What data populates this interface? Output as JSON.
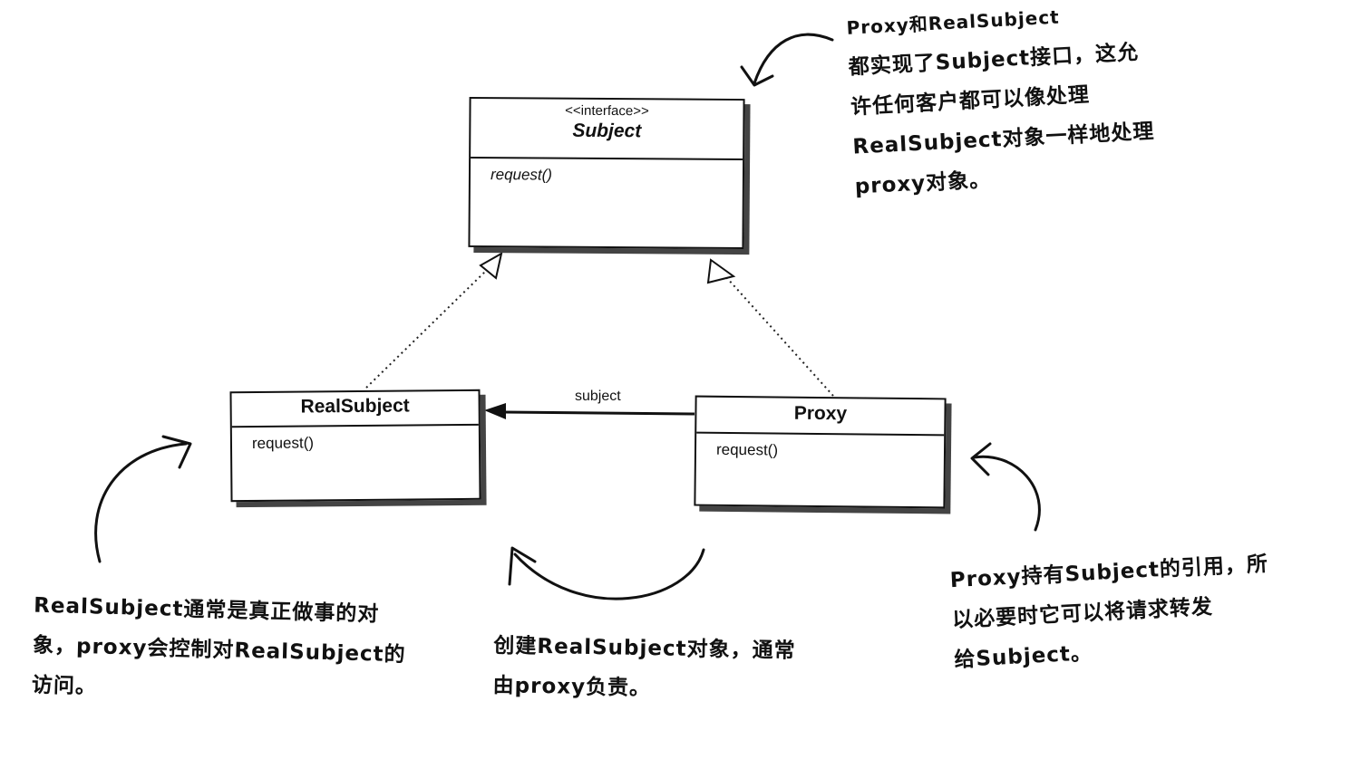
{
  "classes": {
    "subject": {
      "stereotype": "<<interface>>",
      "name": "Subject",
      "operation": "request()"
    },
    "real_subject": {
      "name": "RealSubject",
      "operation": "request()"
    },
    "proxy": {
      "name": "Proxy",
      "operation": "request()"
    }
  },
  "association_label": "subject",
  "notes": {
    "top_right": [
      "Proxy和RealSubject",
      "都实现了Subject接口，这允",
      "许任何客户都可以像处理",
      "RealSubject对象一样地处理",
      "proxy对象。"
    ],
    "bottom_left": [
      "RealSubject通常是真正做事的对",
      "象，proxy会控制对RealSubject的",
      "访问。"
    ],
    "bottom_middle": [
      "创建RealSubject对象，通常",
      "由proxy负责。"
    ],
    "bottom_right": [
      "Proxy持有Subject的引用，所",
      "以必要时它可以将请求转发",
      "给Subject。"
    ]
  }
}
